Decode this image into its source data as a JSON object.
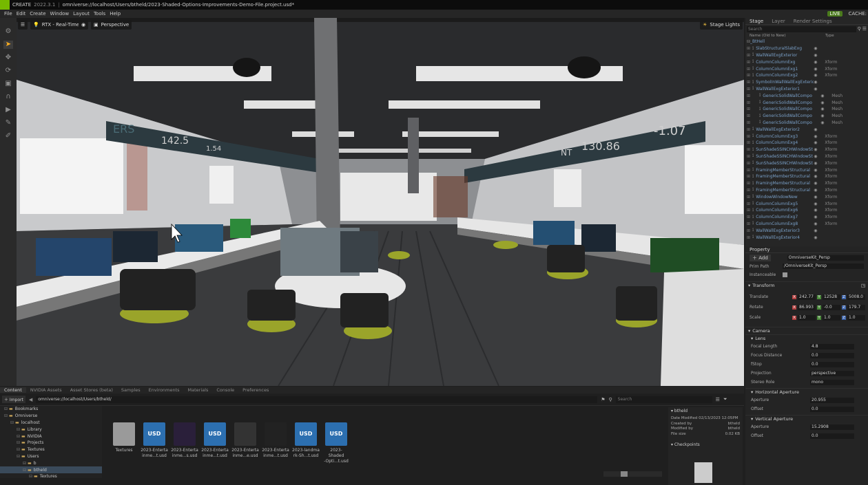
{
  "titlebar": {
    "app": "CREATE",
    "version": "2022.3.1",
    "path": "omniverse://localhost/Users/btheld/2023-Shaded-Options-Improvements-Demo-File.project.usd*"
  },
  "menu": [
    "File",
    "Edit",
    "Create",
    "Window",
    "Layout",
    "Tools",
    "Help"
  ],
  "status": {
    "live": "LIVE",
    "cache": "CACHE:"
  },
  "viewport": {
    "renderer": "RTX - Real-Time",
    "camera": "Perspective",
    "lights": "Stage Lights",
    "ticker_left": [
      "ERS",
      "142.5",
      "1.54"
    ],
    "ticker_right": [
      "NT",
      "130.86",
      "-1.07"
    ]
  },
  "stage": {
    "tabs": [
      "Stage",
      "Layer",
      "Render Settings"
    ],
    "search_placeholder": "Search",
    "col_name": "Name (Old to New)",
    "col_type": "Type",
    "root": "_BtHell",
    "rows": [
      {
        "name": "SlabStructuralSlabExg",
        "type": ""
      },
      {
        "name": "WallWallExgExterior",
        "type": ""
      },
      {
        "name": "ColumnColumnExg",
        "type": "Xform"
      },
      {
        "name": "ColumnColumnExg1",
        "type": "Xform"
      },
      {
        "name": "ColumnColumnExg2",
        "type": "Xform"
      },
      {
        "name": "SymbolInWallWallExgExterior",
        "type": ""
      },
      {
        "name": "WallWallExgExterior1",
        "type": ""
      },
      {
        "name": "GenericSolidWallCompo",
        "type": "Mesh"
      },
      {
        "name": "GenericSolidWallCompo",
        "type": "Mesh"
      },
      {
        "name": "GenericSolidWallCompo",
        "type": "Mesh"
      },
      {
        "name": "GenericSolidWallCompo",
        "type": "Mesh"
      },
      {
        "name": "GenericSolidWallCompo",
        "type": "Mesh"
      },
      {
        "name": "WallWallExgExterior2",
        "type": ""
      },
      {
        "name": "ColumnColumnExg3",
        "type": "Xform"
      },
      {
        "name": "ColumnColumnExg4",
        "type": "Xform"
      },
      {
        "name": "SunShadeSSINCHWindowSt",
        "type": "Xform"
      },
      {
        "name": "SunShadeSSINCHWindowSt",
        "type": "Xform"
      },
      {
        "name": "SunShadeSSINCHWindowSt",
        "type": "Xform"
      },
      {
        "name": "FramingMemberStructural",
        "type": "Xform"
      },
      {
        "name": "FramingMemberStructural",
        "type": "Xform"
      },
      {
        "name": "FramingMemberStructural",
        "type": "Xform"
      },
      {
        "name": "FramingMemberStructural",
        "type": "Xform"
      },
      {
        "name": "WindowWindowNew",
        "type": "Xform"
      },
      {
        "name": "ColumnColumnExg5",
        "type": "Xform"
      },
      {
        "name": "ColumnColumnExg6",
        "type": "Xform"
      },
      {
        "name": "ColumnColumnExg7",
        "type": "Xform"
      },
      {
        "name": "ColumnColumnExg8",
        "type": "Xform"
      },
      {
        "name": "WallWallExgExterior3",
        "type": ""
      },
      {
        "name": "WallWallExgExterior4",
        "type": ""
      }
    ]
  },
  "property": {
    "tab": "Property",
    "add": "Add",
    "name_value": "OmniverseKit_Persp",
    "prim_path_label": "Prim Path",
    "prim_path": "/OmniverseKit_Persp",
    "instanceable": "Instanceable",
    "transform": "Transform",
    "translate_label": "Translate",
    "translate": [
      "242.77",
      "12528",
      "5008.0"
    ],
    "rotate_label": "Rotate",
    "rotate": [
      "86.993",
      "-0.0",
      "179.7"
    ],
    "scale_label": "Scale",
    "scale": [
      "1.0",
      "1.0",
      "1.0"
    ],
    "camera": "Camera",
    "lens": "Lens",
    "focal_label": "Focal Length",
    "focal": "4.8",
    "focus_dist_label": "Focus Distance",
    "focus_dist": "0.0",
    "fstop_label": "fStop",
    "fstop": "0.0",
    "projection_label": "Projection",
    "projection": "perspective",
    "stereo_label": "Stereo Role",
    "stereo": "mono",
    "horiz": "Horizontal Aperture",
    "h_aperture_label": "Aperture",
    "h_aperture": "20.955",
    "h_offset_label": "Offset",
    "h_offset": "0.0",
    "vert": "Vertical Aperture",
    "v_aperture_label": "Aperture",
    "v_aperture": "15.2908",
    "v_offset_label": "Offset",
    "v_offset": "0.0"
  },
  "content": {
    "tabs": [
      "Content",
      "NVIDIA Assets",
      "Asset Stores (beta)",
      "Samples",
      "Environments",
      "Materials",
      "Console",
      "Preferences"
    ],
    "import": "Import",
    "path": "omniverse://localhost/Users/btheld/",
    "search_placeholder": "Search",
    "folders": [
      {
        "label": "Bookmarks",
        "indent": 0
      },
      {
        "label": "Omniverse",
        "indent": 0
      },
      {
        "label": "localhost",
        "indent": 1
      },
      {
        "label": "Library",
        "indent": 2
      },
      {
        "label": "NVIDIA",
        "indent": 2
      },
      {
        "label": "Projects",
        "indent": 2
      },
      {
        "label": "Textures",
        "indent": 2
      },
      {
        "label": "Users",
        "indent": 2
      },
      {
        "label": "b",
        "indent": 3
      },
      {
        "label": "btheld",
        "indent": 3
      },
      {
        "label": "Textures",
        "indent": 4
      }
    ],
    "assets": [
      {
        "label1": "Textures",
        "label2": "",
        "kind": "folder"
      },
      {
        "label1": "2023-Enterta",
        "label2": "inme...t.usd",
        "kind": "usd"
      },
      {
        "label1": "2023-Enterta",
        "label2": "inme...s.usd",
        "kind": "render1"
      },
      {
        "label1": "2023-Enterta",
        "label2": "inme...t.usd",
        "kind": "usd"
      },
      {
        "label1": "2023-Enterta",
        "label2": "inme...e.usd",
        "kind": "render2"
      },
      {
        "label1": "2023-Enterta",
        "label2": "inme...t.usd",
        "kind": "render3"
      },
      {
        "label1": "2023-landma",
        "label2": "rk-Sh...t.usd",
        "kind": "usd"
      },
      {
        "label1": "2023-Shaded",
        "label2": "-Opti...t.usd",
        "kind": "usd"
      }
    ],
    "details": {
      "title": "btheld",
      "date": "Date Modified 02/13/2023 12:05PM",
      "created_label": "Created by",
      "created": "btheld",
      "modified_label": "Modified by",
      "modified": "btheld",
      "size_label": "File size",
      "size": "0.02 KB",
      "checkpoints": "Checkpoints"
    }
  }
}
